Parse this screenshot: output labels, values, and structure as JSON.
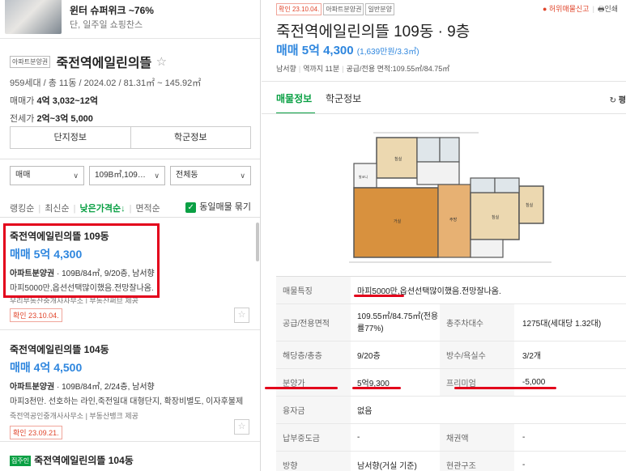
{
  "ad": {
    "title": "윈터 슈퍼위크 ~76%",
    "subtitle": "단, 일주일 쇼핑찬스"
  },
  "complex": {
    "type_tag": "아파트분양권",
    "name": "죽전역에일린의뜰",
    "star_icon": "☆",
    "meta": "959세대 / 총 11동 / 2024.02 / 81.31㎡ ~ 145.92㎡",
    "sale_label": "매매가",
    "sale_value": "4억 3,032~12억",
    "jeonse_label": "전세가",
    "jeonse_value": "2억~3억 5,000",
    "btn_info": "단지정보",
    "btn_school": "학군정보"
  },
  "filters": {
    "deal": "매매",
    "area": "109B㎡,109…",
    "dong": "전체동"
  },
  "sort": {
    "options": [
      "랭킹순",
      "최신순",
      "낮은가격순↓",
      "면적순"
    ],
    "same_listing": "동일매물 묶기"
  },
  "listings": [
    {
      "title": "죽전역에일린의뜰 109동",
      "price": "매매 5억 4,300",
      "spec_bold": "아파트분양권",
      "spec": " · 109B/84㎡, 9/20층, 남서향",
      "desc": "마피5000만,옵션선택많이했음.전망잘나옴.",
      "agent": "우리부동산중개사사무소 | 부동산써브 제공",
      "confirm": "확인 23.10.04."
    },
    {
      "title": "죽전역에일린의뜰 104동",
      "price": "매매 4억 4,500",
      "spec_bold": "아파트분양권",
      "spec": " · 109B/84㎡, 2/24층, 남서향",
      "desc": "마피3천만. 선호하는 라인,죽전일대 대형단지, 확장비별도, 이자후불제",
      "agent": "죽전역공인중개사사무소 | 부동산뱅크 제공",
      "confirm": "확인 23.09.21."
    },
    {
      "badge": "집주인",
      "title": "죽전역에일린의뜰 104동"
    }
  ],
  "detail": {
    "confirm_tag": "확인 23.10.04.",
    "type_tag": "아파트분양권",
    "sale_tag": "일반분양",
    "report": "허위매물신고",
    "print": "인쇄",
    "title": "죽전역에일린의뜰 109동 · 9층",
    "price": "매매 5억 4,300",
    "price_per": "(1,639만원/3.3㎡)",
    "direction": "남서향",
    "distance": "역까지 11분",
    "area": "공급/전용 면적:109.55㎡/84.75㎡",
    "tab_info": "매물정보",
    "tab_school": "학군정보",
    "refresh": "평"
  },
  "table": {
    "feature_label": "매물특징",
    "feature_value": "마피5000만,옵션선택많이했음.전망잘나옴.",
    "area_label": "공급/전용면적",
    "area_value": "109.55㎡/84.75㎡(전용률77%)",
    "parking_label": "총주차대수",
    "parking_value": "1275대(세대당 1.32대)",
    "floor_label": "해당층/총층",
    "floor_value": "9/20층",
    "rooms_label": "방수/욕실수",
    "rooms_value": "3/2개",
    "sale_price_label": "분양가",
    "sale_price_value": "5억9,300",
    "premium_label": "프리미엄",
    "premium_value": "-5,000",
    "loan_label": "융자금",
    "loan_value": "없음",
    "mid_label": "납부중도금",
    "mid_value": "-",
    "bond_label": "채권액",
    "bond_value": "-",
    "dir_label": "방향",
    "dir_value": "남서향(거실 기준)",
    "entry_label": "현관구조",
    "entry_value": "-"
  },
  "colors": {
    "accent_green": "#0aa044",
    "price_blue": "#2e86de",
    "annotation_red": "#e3001b"
  }
}
